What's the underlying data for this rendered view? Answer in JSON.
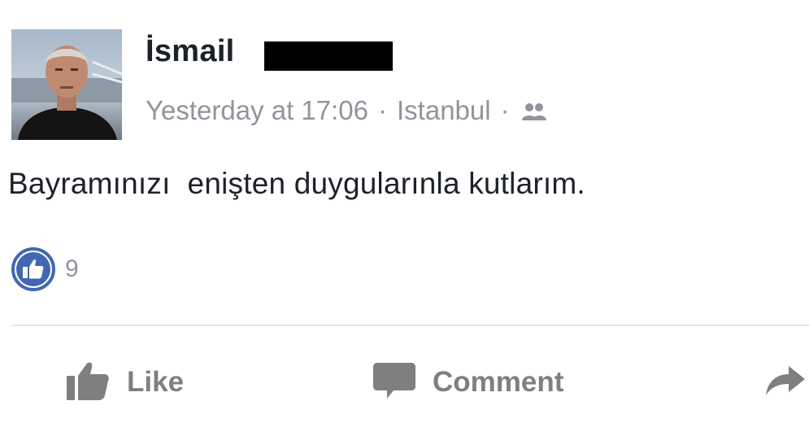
{
  "post": {
    "author_name": "İsmail",
    "author_surname_redacted": true,
    "timestamp": "Yesterday at 17:06",
    "separator": "·",
    "location": "Istanbul",
    "audience_icon": "friends-icon",
    "message": "Bayramınızı  enişten duygularınla kutlarım."
  },
  "reactions": {
    "icon": "like-icon",
    "count": "9",
    "color": "#4267b2"
  },
  "actions": {
    "like_label": "Like",
    "comment_label": "Comment",
    "share_icon": "share-icon"
  },
  "colors": {
    "text_primary": "#1d2129",
    "text_secondary": "#90949c",
    "action_gray": "#7f7f7f",
    "like_blue": "#4267b2"
  }
}
